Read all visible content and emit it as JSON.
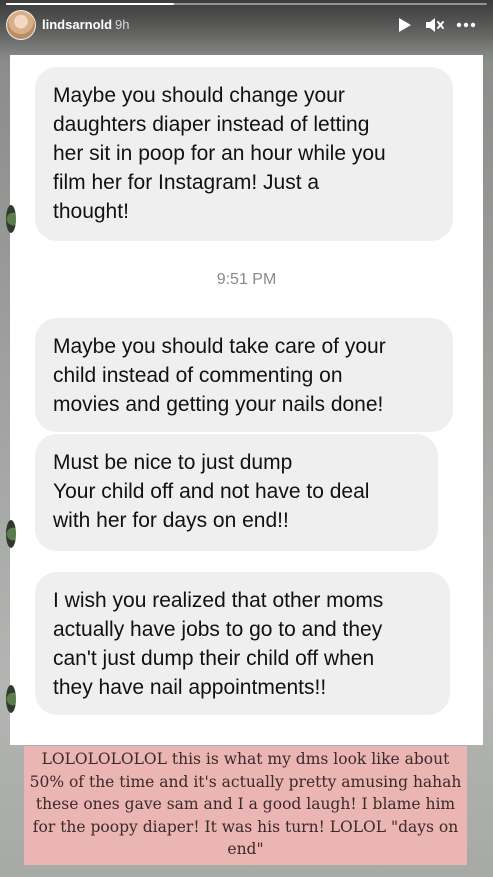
{
  "story": {
    "username": "lindsarnold",
    "time_ago": "9h",
    "progress": 0.35,
    "icons": {
      "play": "play-icon",
      "mute": "muted-speaker-icon",
      "more": "more-horizontal-icon"
    }
  },
  "messages": [
    {
      "text": "Maybe you should change your\ndaughters diaper instead of letting\nher sit in poop for an hour while you\nfilm her for Instagram! Just a\nthought!"
    },
    {
      "text": "Maybe you should take care of your\nchild instead of commenting on\nmovies and getting your nails done!"
    },
    {
      "text": "Must be nice to just dump\nYour child off and not have to deal\nwith her for days on end!!"
    },
    {
      "text": "I wish you realized that other moms\nactually have jobs to go to and they\ncan't just dump their child off when\nthey have nail appointments!!"
    }
  ],
  "timestamp": "9:51 PM",
  "caption": "LOLOLOLOLOL this is what my dms look like about 50% of the time and it's actually pretty amusing hahah these ones gave sam and I a good laugh! I blame him for the poopy diaper! It was his turn! LOLOL \"days on end\"",
  "colors": {
    "caption_bg": "#eab5b3",
    "bubble_bg": "#efefef"
  }
}
